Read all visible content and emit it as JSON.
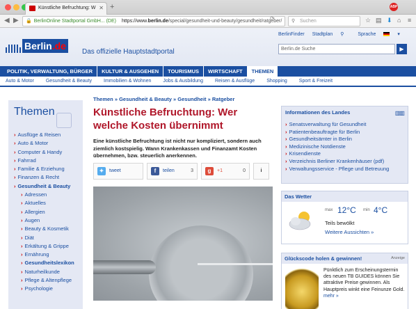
{
  "browser": {
    "tab_title": "Künstliche Befruchtung: W",
    "url_secure": "BerlinOnline Stadtportal GmbH... (DE)",
    "url_prefix": "https://www.",
    "url_host": "berlin.de",
    "url_path": "/special/gesundheit-und-beauty/gesundheit/ratgeber/",
    "search_placeholder": "Suchen",
    "adblock_badge": "ABP"
  },
  "header": {
    "logo_text": "Berlin",
    "logo_suffix": ".de",
    "claim": "Das offizielle Hauptstadtportal",
    "links": [
      "BerlinFinder",
      "Stadtplan",
      "Sprache"
    ],
    "search_placeholder": "Berlin.de Suche"
  },
  "main_nav": [
    {
      "label": "POLITIK, VERWALTUNG, BÜRGER",
      "active": false
    },
    {
      "label": "KULTUR & AUSGEHEN",
      "active": false
    },
    {
      "label": "TOURISMUS",
      "active": false
    },
    {
      "label": "WIRTSCHAFT",
      "active": false
    },
    {
      "label": "THEMEN",
      "active": true
    }
  ],
  "sub_nav": [
    "Auto & Motor",
    "Gesundheit & Beauty",
    "Immobilien & Wohnen",
    "Jobs & Ausbildung",
    "Reisen & Ausflüge",
    "Shopping",
    "Sport & Freizeit"
  ],
  "sidebar": {
    "title": "Themen",
    "items": [
      {
        "label": "Ausflüge & Reisen",
        "level": 0
      },
      {
        "label": "Auto & Motor",
        "level": 0
      },
      {
        "label": "Computer & Handy",
        "level": 0
      },
      {
        "label": "Fahrrad",
        "level": 0
      },
      {
        "label": "Familie & Erziehung",
        "level": 0
      },
      {
        "label": "Finanzen & Recht",
        "level": 0
      },
      {
        "label": "Gesundheit & Beauty",
        "level": 0,
        "bold": true
      },
      {
        "label": "Adressen",
        "level": 1
      },
      {
        "label": "Aktuelles",
        "level": 1
      },
      {
        "label": "Allergien",
        "level": 1
      },
      {
        "label": "Augen",
        "level": 1
      },
      {
        "label": "Beauty & Kosmetik",
        "level": 1
      },
      {
        "label": "Diät",
        "level": 1
      },
      {
        "label": "Erkältung & Grippe",
        "level": 1
      },
      {
        "label": "Ernährung",
        "level": 1
      },
      {
        "label": "Gesundheitslexikon",
        "level": 1,
        "bold": true
      },
      {
        "label": "Naturheilkunde",
        "level": 1
      },
      {
        "label": "Pflege & Altenpflege",
        "level": 1
      },
      {
        "label": "Psychologie",
        "level": 1
      }
    ]
  },
  "article": {
    "breadcrumb": "Themen » Gesundheit & Beauty » Gesundheit » Ratgeber",
    "title": "Künstliche Befruchtung: Wer welche Kosten übernimmt",
    "lead": "Eine künstliche Befruchtung ist nicht nur kompliziert, sondern auch ziemlich kostspielig. Wann Krankenkassen und Finanzamt Kosten übernehmen, bzw. steuerlich anerkennen.",
    "share": {
      "tweet": "tweet",
      "facebook": "teilen",
      "facebook_count": "3",
      "gplus": "+1",
      "gplus_count": "0",
      "info": "i"
    }
  },
  "infobox": {
    "title": "Informationen des Landes",
    "links": [
      "Senatsverwaltung für Gesundheit",
      "Patientenbeauftragte für Berlin",
      "Gesundheitsämter in Berlin",
      "Medizinische Notdienste",
      "Krisendienste",
      "Verzeichnis Berliner Krankenhäuser (pdf)",
      "Verwaltungsservice - Pflege und Betreuung"
    ]
  },
  "weather": {
    "title": "Das Wetter",
    "max_label": "max",
    "max_value": "12°C",
    "min_label": "min",
    "min_value": "4°C",
    "description": "Teils bewölkt",
    "more_link": "Weitere Aussichten »"
  },
  "lucky": {
    "title": "Glückscode holen & gewinnen!",
    "ad_label": "Anzeige",
    "text": "Pünktlich zum Erscheinungstermin des neuen TB GUIDES können Sie attraktive Preise gewinnen. Als Hauptpreis winkt eine Feinunze Gold.",
    "more": "mehr »"
  },
  "colors": {
    "brand": "#1b4fa1",
    "title_red": "#b0172a",
    "accent_red": "#cc0000"
  }
}
